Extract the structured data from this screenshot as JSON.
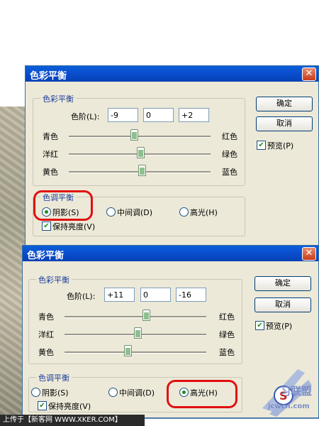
{
  "dialog1": {
    "title": "色彩平衡",
    "close_glyph": "✕",
    "balance_group": "色彩平衡",
    "levels_label": "色阶(L):",
    "levels": [
      "-9",
      "0",
      "+2"
    ],
    "sliders": [
      {
        "left": "青色",
        "right": "红色",
        "value": -9
      },
      {
        "left": "洋红",
        "right": "绿色",
        "value": 0
      },
      {
        "left": "黄色",
        "right": "蓝色",
        "value": 2
      }
    ],
    "tone_group": "色调平衡",
    "tones": {
      "shadows": "阴影(S)",
      "midtones": "中间调(D)",
      "highlights": "高光(H)"
    },
    "selected_tone": "shadows",
    "preserve": "保持亮度(V)",
    "ok": "确定",
    "cancel": "取消",
    "preview": "预览(P)"
  },
  "dialog2": {
    "title": "色彩平衡",
    "close_glyph": "✕",
    "balance_group": "色彩平衡",
    "levels_label": "色阶(L):",
    "levels": [
      "+11",
      "0",
      "-16"
    ],
    "sliders": [
      {
        "left": "青色",
        "right": "红色",
        "value": 11
      },
      {
        "left": "洋红",
        "right": "绿色",
        "value": 0
      },
      {
        "left": "黄色",
        "right": "蓝色",
        "value": -16
      }
    ],
    "tone_group": "色调平衡",
    "tones": {
      "shadows": "阴影(S)",
      "midtones": "中间调(D)",
      "highlights": "高光(H)"
    },
    "selected_tone": "highlights",
    "preserve": "保持亮度(V)",
    "ok": "确定",
    "cancel": "取消",
    "preview": "预览(P)"
  },
  "footer": "上传于【新客网 WWW.XKER.COM】",
  "watermark": {
    "logo": "S",
    "brand": "习联盟",
    "site": "jcwcn.com"
  },
  "colors": {
    "highlight": "#e01010",
    "titlebar": "#0a4fd0"
  }
}
